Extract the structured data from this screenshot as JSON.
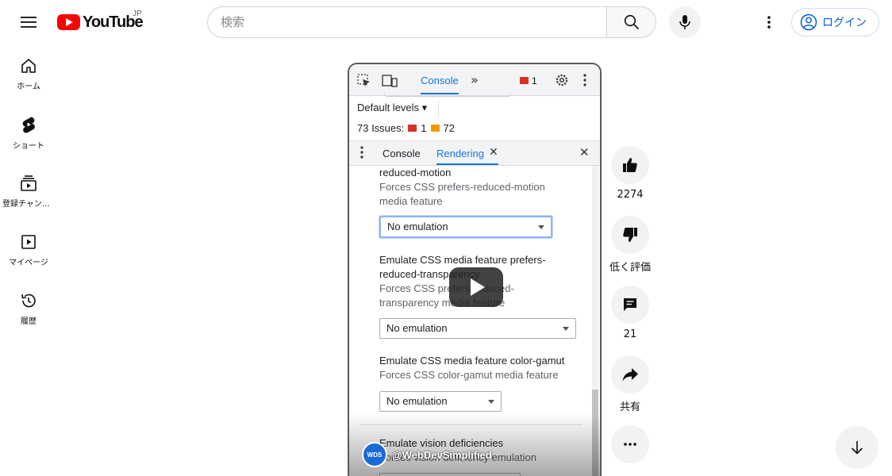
{
  "header": {
    "logo_text": "YouTube",
    "region": "JP",
    "search_placeholder": "検索",
    "login_label": "ログイン"
  },
  "sidebar": {
    "items": [
      {
        "label": "ホーム",
        "icon": "home-icon"
      },
      {
        "label": "ショート",
        "icon": "shorts-icon"
      },
      {
        "label": "登録チャンネル",
        "icon": "subscriptions-icon"
      },
      {
        "label": "マイページ",
        "icon": "you-icon"
      },
      {
        "label": "履歴",
        "icon": "history-icon"
      }
    ]
  },
  "video": {
    "devtools": {
      "tab_console": "Console",
      "error_count": "1",
      "default_levels": "Default levels ▾",
      "issues_label": "73 Issues:",
      "issues_errors": "1",
      "issues_warnings": "72",
      "drawer_tab_console": "Console",
      "drawer_tab_rendering": "Rendering",
      "sections": [
        {
          "title": "reduced-motion",
          "desc_1": "Forces CSS prefers-reduced-motion",
          "desc_2": "media feature",
          "select": "No emulation"
        },
        {
          "title_1": "Emulate CSS media feature prefers-",
          "title_2": "reduced-transparency",
          "desc_1": "Forces CSS prefers-reduced-",
          "desc_2": "transparency media feature",
          "select": "No emulation"
        },
        {
          "title": "Emulate CSS media feature color-gamut",
          "desc": "Forces CSS color-gamut media feature",
          "select": "No emulation"
        },
        {
          "title": "Emulate vision deficiencies",
          "desc": "Forces vision deficiency emulation"
        }
      ]
    },
    "channel_handle": "@WebDevSimplified",
    "channel_avatar_text": "WDS"
  },
  "actions": {
    "like_count": "2274",
    "dislike_label": "低く評価",
    "comment_count": "21",
    "share_label": "共有"
  }
}
